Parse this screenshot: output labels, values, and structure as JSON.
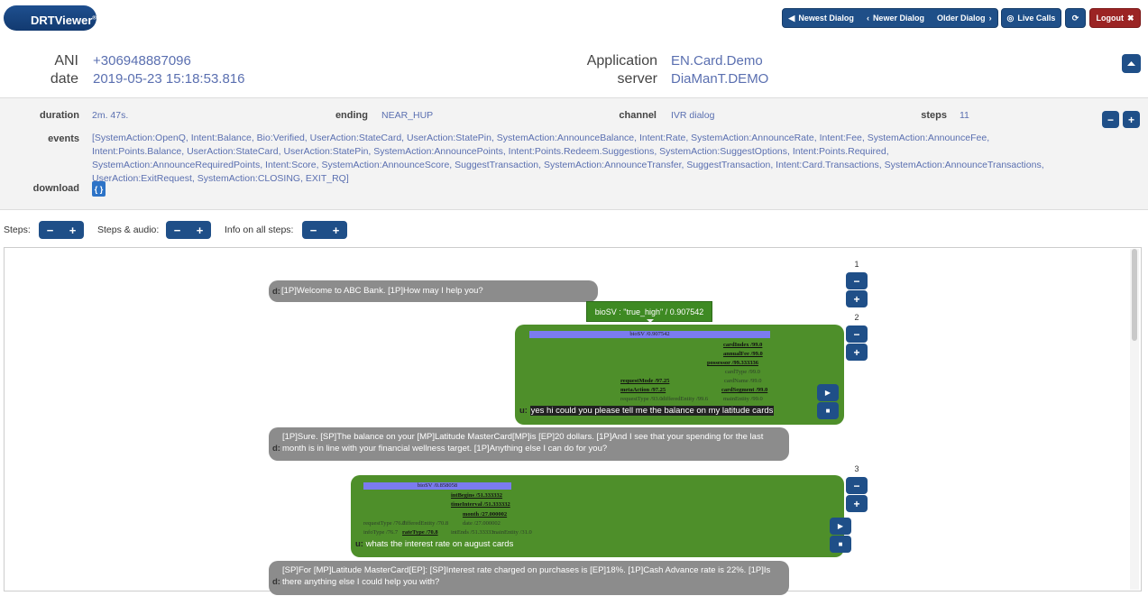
{
  "app": {
    "title": "DRTViewer",
    "mark": "®"
  },
  "nav": {
    "newest": "Newest Dialog",
    "newer": "Newer Dialog",
    "older": "Older Dialog",
    "live": "Live Calls",
    "logout": "Logout"
  },
  "header": {
    "ani_label": "ANI",
    "ani": "+306948887096",
    "date_label": "date",
    "date": "2019-05-23 15:18:53.816",
    "application_label": "Application",
    "application": "EN.Card.Demo",
    "server_label": "server",
    "server": "DiaManT.DEMO"
  },
  "details": {
    "duration_label": "duration",
    "duration": "2m. 47s.",
    "ending_label": "ending",
    "ending": "NEAR_HUP",
    "channel_label": "channel",
    "channel": "IVR dialog",
    "steps_label": "steps",
    "steps": "11",
    "events_label": "events",
    "events": "[SystemAction:OpenQ, Intent:Balance, Bio:Verified, UserAction:StateCard, UserAction:StatePin, SystemAction:AnnounceBalance, Intent:Rate, SystemAction:AnnounceRate, Intent:Fee, SystemAction:AnnounceFee, Intent:Points.Balance, UserAction:StateCard, UserAction:StatePin, SystemAction:AnnouncePoints, Intent:Points.Redeem.Suggestions, SystemAction:SuggestOptions, Intent:Points.Required, SystemAction:AnnounceRequiredPoints, Intent:Score, SystemAction:AnnounceScore, SuggestTransaction, SystemAction:AnnounceTransfer, SuggestTransaction, Intent:Card.Transactions, SystemAction:AnnounceTransactions, UserAction:ExitRequest, SystemAction:CLOSING, EXIT_RQ]",
    "download_label": "download",
    "download_icon": "{ }"
  },
  "controls": {
    "steps_label": "Steps:",
    "steps_audio_label": "Steps & audio:",
    "info_label": "Info on all steps:",
    "minus": "−",
    "plus": "+"
  },
  "dialog": {
    "step1": {
      "num": "1",
      "tag": "d:",
      "text": "[1P]Welcome to ABC Bank. [1P]How may I help you?"
    },
    "step2": {
      "num": "2",
      "tooltip": "bioSV : \"true_high\" / 0.907542",
      "bar": "bioSV /0.907542",
      "slots": [
        "cardIndex /99.0",
        "annualFee /99.0",
        "possessor /99.333336",
        "cardType /99.0",
        "requestMode /97.25",
        "cardName /99.0",
        "metaAction /97.25",
        "cardSegment /99.0",
        "requestType /93.0",
        "differedEntity /99.6",
        "mainEntity /99.0"
      ],
      "tag": "u:",
      "utterance": "yes hi could you please tell me the balance on my latitude cards"
    },
    "step2_reply": {
      "tag": "d:",
      "text": "[1P]Sure. [SP]The balance on your [MP]Latitude MasterCard[MP]is [EP]20 dollars. [1P]And I see that your spending for the last month is in line with your financial wellness target. [1P]Anything else I can do for you?"
    },
    "step3": {
      "num": "3",
      "bar": "bioSV /0.858058",
      "slots": [
        "intBegins /51.333332",
        "timeInterval /51.333332",
        "month /27.000002",
        "requestType /76.7",
        "differedEntity /70.8",
        "date /27.000002",
        "infoType /76.7",
        "rateType /70.8",
        "intEnds /51.33333",
        "mainEntity /31.0"
      ],
      "tag": "u:",
      "utterance": "whats the interest rate on august cards"
    },
    "step3_reply": {
      "tag": "d:",
      "text": "[SP]For [MP]Latitude MasterCard[EP]: [SP]Interest rate charged on purchases is [EP]18%. [1P]Cash Advance rate is 22%. [1P]Is there anything else I could help you with?"
    },
    "play_icon": "▶",
    "stop_icon": "■"
  }
}
